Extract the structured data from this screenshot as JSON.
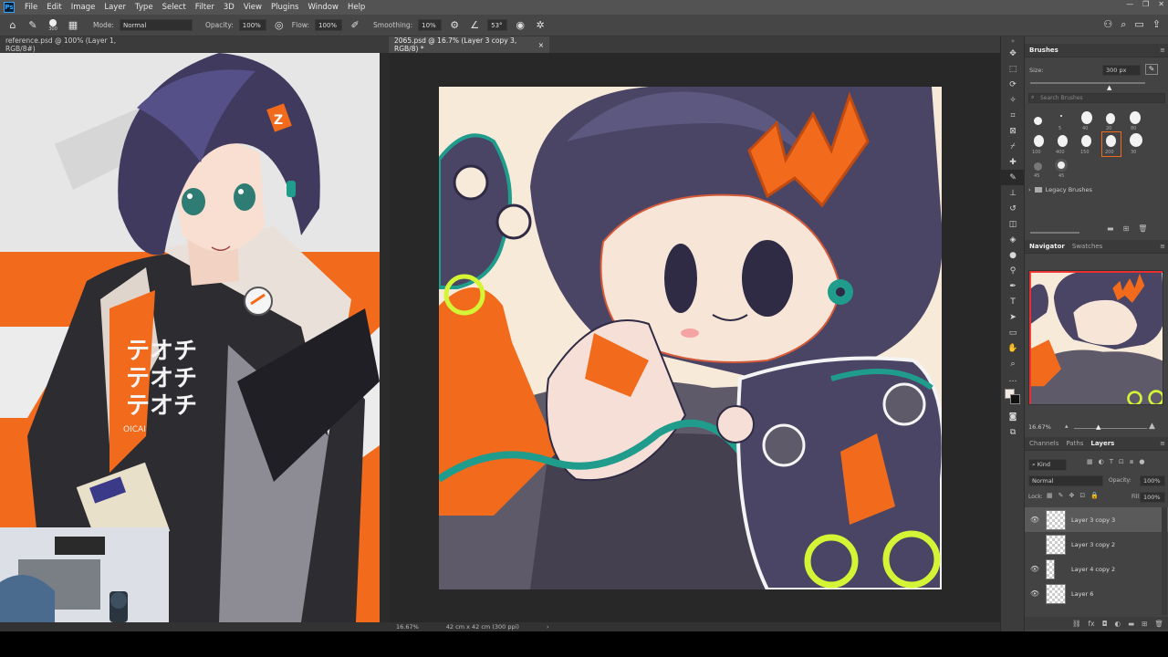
{
  "menu": {
    "logo": "Ps",
    "items": [
      "File",
      "Edit",
      "Image",
      "Layer",
      "Type",
      "Select",
      "Filter",
      "3D",
      "View",
      "Plugins",
      "Window",
      "Help"
    ]
  },
  "options": {
    "brush_size": "300",
    "mode_label": "Mode:",
    "mode_value": "Normal",
    "opacity_label": "Opacity:",
    "opacity_value": "100%",
    "flow_label": "Flow:",
    "flow_value": "100%",
    "smoothing_label": "Smoothing:",
    "smoothing_value": "10%",
    "angle_value": "53°"
  },
  "tabs": {
    "reference": "reference.psd @ 100% (Layer 1, RGB/8#)",
    "main": "2065.psd @ 16.7% (Layer 3 copy 3, RGB/8) *",
    "close": "×"
  },
  "status": {
    "zoom": "16.67%",
    "doc_size": "42 cm x 42 cm (300 ppi)",
    "arrow": "›"
  },
  "brushes_panel": {
    "title": "Brushes",
    "size_label": "Size:",
    "size_value": "300 px",
    "search_placeholder": "Search Brushes",
    "folder": "Legacy Brushes",
    "tips": [
      "5",
      "40",
      "20",
      "80",
      "100",
      "400",
      "150",
      "200",
      "30",
      "45",
      "45"
    ]
  },
  "navigator_panel": {
    "tabs": [
      "Navigator",
      "Swatches"
    ],
    "zoom": "16.67%"
  },
  "layers_panel": {
    "tabs": [
      "Channels",
      "Paths",
      "Layers"
    ],
    "kind": "Kind",
    "blend": "Normal",
    "opacity_label": "Opacity:",
    "opacity_value": "100%",
    "lock_label": "Lock:",
    "fill_label": "Fill:",
    "fill_value": "100%",
    "layers": [
      "Layer 3 copy 3",
      "Layer 3 copy 2",
      "Layer 4 copy 2",
      "Layer 6"
    ]
  },
  "reference_art": {
    "shirt_text_1": "テオチ",
    "shirt_text_2": "テオチ",
    "shirt_text_3": "テオチ",
    "shirt_small": "OICAI",
    "hairpin": "Z"
  },
  "colors": {
    "ps_blue": "#31a8ff",
    "orange": "#f26b1d",
    "teal": "#1f9c8c",
    "lime": "#d4f535",
    "hair": "#3f3a5e"
  }
}
